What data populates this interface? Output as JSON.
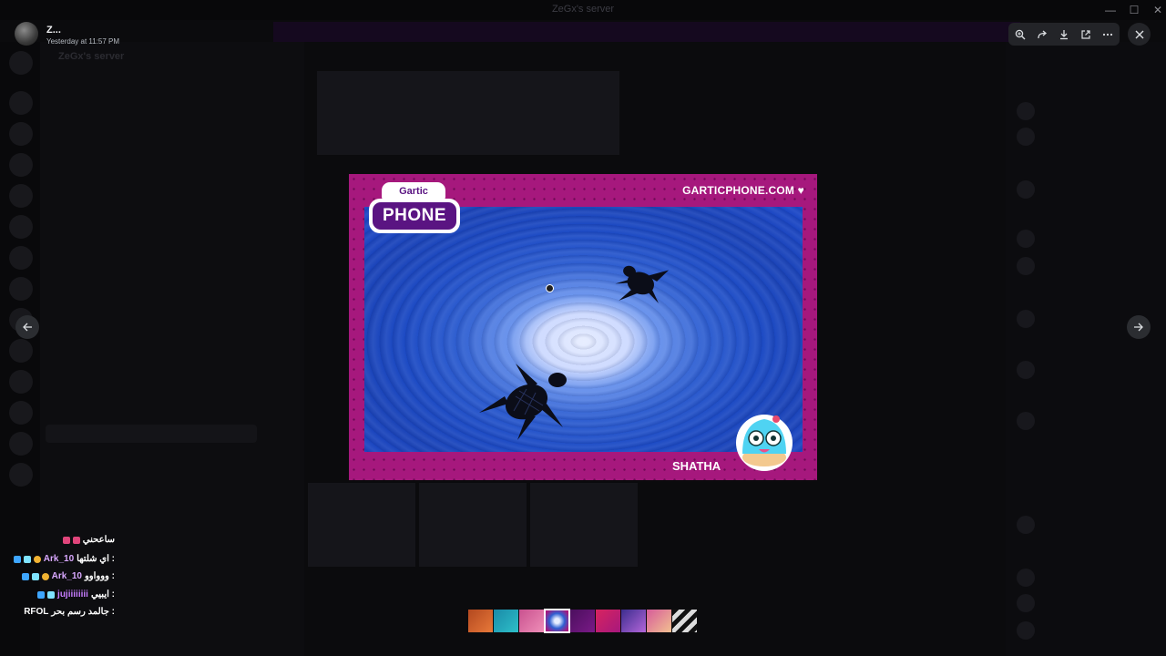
{
  "background_app": {
    "window_title": "ZeGx's server",
    "server_name": "ZeGx's server",
    "banner_text": "",
    "channel_header": "",
    "window_controls": [
      "—",
      "☐",
      "✕"
    ]
  },
  "viewer": {
    "user": {
      "name": "Z...",
      "timestamp": "Yesterday at 11:57 PM"
    },
    "toolbar": {
      "icons": [
        "zoom-icon",
        "forward-icon",
        "download-icon",
        "open-external-icon",
        "more-icon"
      ]
    },
    "close_icon": "close-icon",
    "prev_icon": "arrow-left-icon",
    "next_icon": "arrow-right-icon"
  },
  "image": {
    "brand_url": "GARTICPHONE.COM",
    "logo_top": "Gartic",
    "logo_main": "PHONE",
    "artist": "SHATHA",
    "colors": {
      "frame": "#a6187d",
      "canvas": "#1c4ac4",
      "logo_purple": "#5a1482"
    }
  },
  "chat_overlay": [
    {
      "user": "",
      "text": "ساعحني",
      "badges": [
        "pink",
        "pink"
      ]
    },
    {
      "user": "Ark_10",
      "text": "اي شلتها :",
      "badges": [
        "blue",
        "cyan",
        "gold"
      ]
    },
    {
      "user": "Ark_10",
      "text": "ووواوو :",
      "badges": [
        "blue",
        "cyan",
        "gold"
      ]
    },
    {
      "user": "jujiiiiiiii",
      "text": "ايبيي :",
      "badges": [
        "blue",
        "cyan"
      ]
    },
    {
      "user": "RFOL",
      "text": "جالمد رسم بحر :",
      "badges": []
    }
  ],
  "filmstrip": {
    "count": 9,
    "active_index": 3
  }
}
